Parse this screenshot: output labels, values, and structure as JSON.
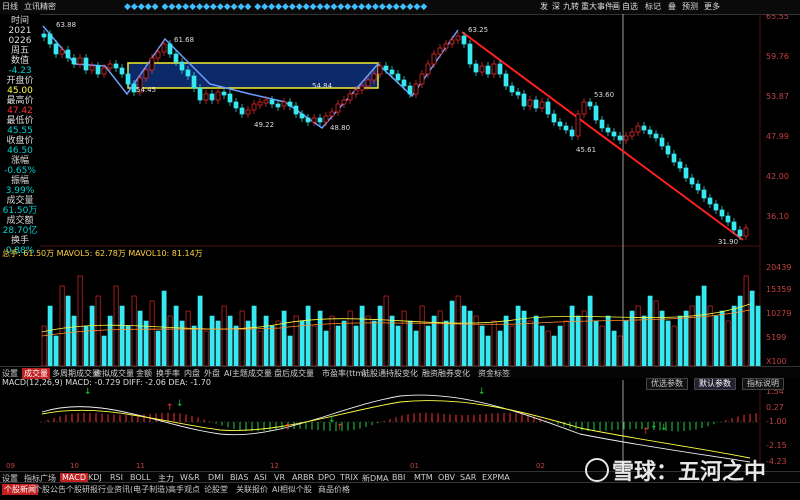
{
  "topbar": {
    "left_labels": [
      "日线",
      "立讯精密"
    ],
    "right_labels": [
      "发",
      "深",
      "九转",
      "重大事件",
      "画",
      "自选",
      "标记",
      "叠",
      "预测",
      "更多"
    ]
  },
  "info_panel": {
    "rows": [
      {
        "label": "时间",
        "value": "2021"
      },
      {
        "label": "",
        "value": "0226"
      },
      {
        "label": "周五",
        "value": ""
      },
      {
        "label": "数值",
        "value": "-4.23"
      },
      {
        "label": "开盘价",
        "value": "45.00"
      },
      {
        "label": "最高价",
        "value": "47.42"
      },
      {
        "label": "最低价",
        "value": "45.55"
      },
      {
        "label": "收盘价",
        "value": "46.50"
      },
      {
        "label": "涨幅",
        "value": "-0.65%"
      },
      {
        "label": "振幅",
        "value": "3.99%"
      },
      {
        "label": "成交量",
        "value": "61.50万"
      },
      {
        "label": "成交额",
        "value": "28.70亿"
      },
      {
        "label": "换手",
        "value": "0.88%"
      }
    ]
  },
  "price_chart": {
    "y_ticks": [
      "65.55",
      "59.76",
      "53.87",
      "47.99",
      "42.00",
      "36.10"
    ],
    "annotations": [
      "63.88",
      "61.68",
      "54.45",
      "54.84",
      "49.22",
      "48.80",
      "63.25",
      "53.60",
      "45.61",
      "31.90"
    ]
  },
  "volume_chart": {
    "legend": "总手: 61.50万  MAVOL5: 62.78万  MAVOL10: 81.14万",
    "y_ticks": [
      "20439",
      "15359",
      "10279",
      "5199",
      "X100"
    ]
  },
  "tabs_row1": [
    "设置",
    "成交量",
    "多周期成交量",
    "虚拟成交量",
    "金额",
    "换手率",
    "内盘",
    "外盘",
    "AI主题成交量",
    "盘后成交量",
    "市盈率(ttm)",
    "陆股通持股变化",
    "融资融券变化",
    "资金标签"
  ],
  "macd_options": [
    "优选参数",
    "默认参数",
    "指标说明"
  ],
  "macd": {
    "legend": "MACD(12,26,9)  MACD: -0.729  DIFF: -2.06  DEA: -1.70",
    "y_ticks": [
      "1.54",
      "0.27",
      "-1.00",
      "-2.15",
      "-4.23"
    ],
    "x_ticks": [
      "09",
      "10",
      "11",
      "12",
      "01",
      "02"
    ]
  },
  "tabs_row2": [
    "设置",
    "指标广场",
    "MACD",
    "KDJ",
    "RSI",
    "BOLL",
    "主力",
    "W&R",
    "DMI",
    "BIAS",
    "ASI",
    "VR",
    "ARBR",
    "DPO",
    "TRIX",
    "新DMA",
    "BBI",
    "MTM",
    "OBV",
    "SAR",
    "EXPMA"
  ],
  "bottom_tabs": [
    "个股新闻",
    "个股公告",
    "个股研报",
    "行业资讯(电子制造)",
    "高手观点",
    "论股堂",
    "关联报价",
    "AI相似个股",
    "商品价格"
  ],
  "watermark": "雪球：五河之中",
  "colors": {
    "up": "#ff3030",
    "down": "#38e8f0",
    "accent": "#c02020",
    "ma": "#ffff40"
  }
}
